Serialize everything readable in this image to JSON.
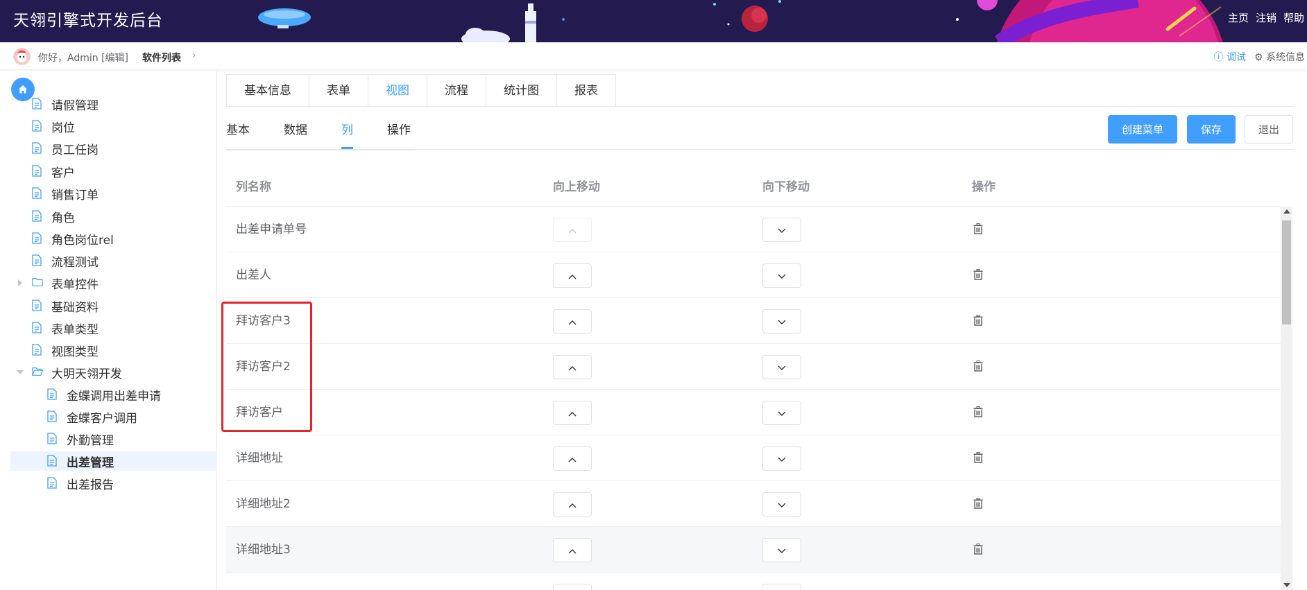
{
  "app": {
    "title": "天翎引擎式开发后台"
  },
  "header_links": [
    "主页",
    "注销",
    "帮助"
  ],
  "subbar": {
    "greeting": "你好，Admin [编辑]",
    "breadcrumb": "软件列表",
    "debug": "调试",
    "sysinfo": "系统信息"
  },
  "sidebar": {
    "items": [
      {
        "label": "请假管理"
      },
      {
        "label": "岗位"
      },
      {
        "label": "员工任岗"
      },
      {
        "label": "客户"
      },
      {
        "label": "销售订单"
      },
      {
        "label": "角色"
      },
      {
        "label": "角色岗位rel"
      },
      {
        "label": "流程测试"
      },
      {
        "label": "表单控件"
      },
      {
        "label": "基础资料"
      },
      {
        "label": "表单类型"
      },
      {
        "label": "视图类型"
      },
      {
        "label": "大明天翎开发"
      },
      {
        "label": "金蝶调用出差申请"
      },
      {
        "label": "金蝶客户调用"
      },
      {
        "label": "外勤管理"
      },
      {
        "label": "出差管理"
      },
      {
        "label": "出差报告"
      }
    ]
  },
  "tabs_primary": [
    "基本信息",
    "表单",
    "视图",
    "流程",
    "统计图",
    "报表"
  ],
  "tabs_secondary": [
    "基本",
    "数据",
    "列",
    "操作"
  ],
  "buttons": {
    "create_menu": "创建菜单",
    "save": "保存",
    "exit": "退出"
  },
  "table": {
    "headers": [
      "列名称",
      "向上移动",
      "向下移动",
      "操作"
    ],
    "rows": [
      {
        "name": "出差申请单号"
      },
      {
        "name": "出差人"
      },
      {
        "name": "拜访客户3"
      },
      {
        "name": "拜访客户2"
      },
      {
        "name": "拜访客户"
      },
      {
        "name": "详细地址"
      },
      {
        "name": "详细地址2"
      },
      {
        "name": "详细地址3"
      }
    ]
  },
  "colors": {
    "accent": "#409eff",
    "header_bg": "#231a4f",
    "highlight": "#e8232b"
  }
}
